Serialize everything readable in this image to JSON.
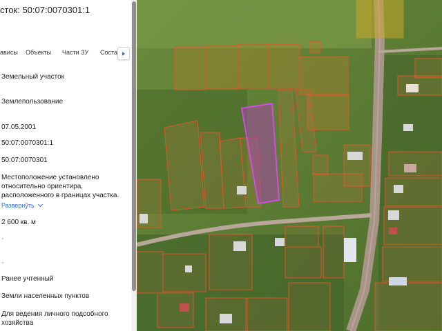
{
  "panel": {
    "title": "сток: 50:07:0070301:1",
    "tabs": [
      "ависы",
      "Объекты",
      "Части ЗУ",
      "Соста"
    ],
    "fields": {
      "object_type": "Земельный участок",
      "category_kind": "Землепользование",
      "reg_date": "07.05.2001",
      "cadastral_number": "50:07:0070301:1",
      "quarter_number": "50:07:0070301",
      "location": "Местоположение установлено относительно ориентира, расположенного в границах участка.",
      "expand_link": "Развернўть",
      "area": "2 600 кв. м",
      "dash_1": "-",
      "dash_2": "-",
      "status": "Ранее учтенный",
      "land_category": "Земли населенных пунктов",
      "permitted_use": "Для ведения личного подсобного хозяйства"
    }
  },
  "map": {
    "selected_parcel_color": "#c040c8",
    "parcel_border_color": "#e0562a",
    "road_color": "#b9a89a"
  }
}
